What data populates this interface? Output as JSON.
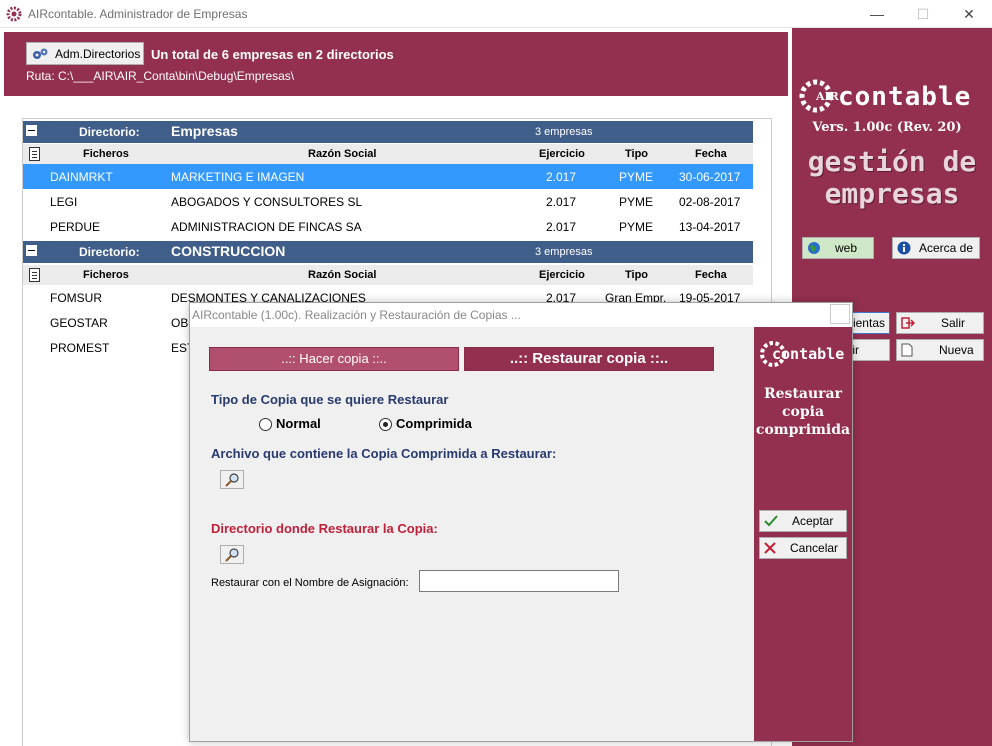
{
  "window": {
    "title": "AIRcontable. Administrador de Empresas",
    "minimize": "—",
    "maximize": "☐",
    "close": "✕"
  },
  "header": {
    "adm_button": "Adm.Directorios",
    "total": "Un total de 6 empresas en 2 directorios",
    "ruta": "Ruta: C:\\___AIR\\AIR_Conta\\bin\\Debug\\Empresas\\"
  },
  "right_panel": {
    "logo_small": "AIR",
    "logo_text": "contable",
    "version": "Vers. 1.00c (Rev. 20)",
    "gestion_line1": "gestión de",
    "gestion_line2": "empresas",
    "web": "web",
    "acerca": "Acerca de",
    "herramientas_partial": "mientas",
    "salir": "Salir",
    "abrir_partial": "rir",
    "nueva": "Nueva"
  },
  "columns": {
    "ficheros": "Ficheros",
    "razon": "Razón Social",
    "ejercicio": "Ejercicio",
    "tipo": "Tipo",
    "fecha": "Fecha"
  },
  "directories": [
    {
      "label": "Directorio:",
      "name": "Empresas",
      "count": "3 empresas",
      "rows": [
        {
          "fichero": "DAINMRKT",
          "razon": "MARKETING E IMAGEN",
          "ejercicio": "2.017",
          "tipo": "PYME",
          "fecha": "30-06-2017"
        },
        {
          "fichero": "LEGI",
          "razon": "ABOGADOS Y CONSULTORES SL",
          "ejercicio": "2.017",
          "tipo": "PYME",
          "fecha": "02-08-2017"
        },
        {
          "fichero": "PERDUE",
          "razon": "ADMINISTRACION DE FINCAS SA",
          "ejercicio": "2.017",
          "tipo": "PYME",
          "fecha": "13-04-2017"
        }
      ]
    },
    {
      "label": "Directorio:",
      "name": "CONSTRUCCION",
      "count": "3 empresas",
      "rows": [
        {
          "fichero": "FOMSUR",
          "razon": "DESMONTES Y CANALIZACIONES",
          "ejercicio": "2.017",
          "tipo": "Gran Empr.",
          "fecha": "19-05-2017"
        },
        {
          "fichero": "GEOSTAR",
          "razon": "OBI",
          "ejercicio": "",
          "tipo": "",
          "fecha": ""
        },
        {
          "fichero": "PROMEST",
          "razon": "EST",
          "ejercicio": "",
          "tipo": "",
          "fecha": ""
        }
      ]
    }
  ],
  "dialog": {
    "title": "AIRcontable (1.00c). Realización y Restauración de Copias ...",
    "tab_hacer": "..:: Hacer copia ::..",
    "tab_restaurar": "..:: Restaurar copia ::..",
    "tipo_label": "Tipo de Copia que se quiere Restaurar",
    "radio_normal": "Normal",
    "radio_comprimida": "Comprimida",
    "archivo_label": "Archivo que contiene la Copia Comprimida a Restaurar:",
    "directorio_label": "Directorio donde Restaurar la Copia:",
    "nombre_label": "Restaurar con el Nombre de Asignación:",
    "nombre_value": "",
    "side_logo": "contable",
    "side_line1": "Restaurar",
    "side_line2": "copia",
    "side_line3": "comprimida",
    "aceptar": "Aceptar",
    "cancelar": "Cancelar"
  },
  "colors": {
    "brand": "#93304f",
    "dirbar": "#3f5e8a",
    "selected": "#3399ff"
  }
}
